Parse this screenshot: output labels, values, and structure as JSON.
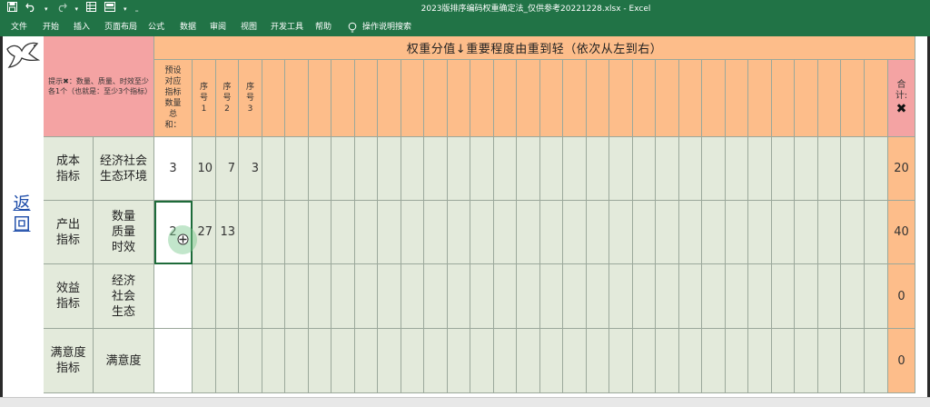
{
  "titlebar": {
    "doc_title": "2023版排序编码权重确定法_仅供参考20221228.xlsx  -  Excel",
    "qat": {
      "save_icon": "save-icon",
      "undo_icon": "undo-icon",
      "redo_icon": "redo-icon",
      "customize_icon": "dropdown-icon"
    }
  },
  "ribbon": {
    "tabs": [
      "文件",
      "开始",
      "插入",
      "页面布局",
      "公式",
      "数据",
      "审阅",
      "视图",
      "开发工具",
      "帮助"
    ],
    "tell_me": "操作说明搜索",
    "tell_me_icon": "lightbulb-icon"
  },
  "sheet": {
    "back_label": "返回",
    "logo_icon": "dove-icon",
    "header_banner": "权重分值↓重要程度由重到轻（依次从左到右）",
    "hint_text": "提示✖：数量、质量、时效至少各1个（也就是：至少3个指标）",
    "preset_header": "预设对应指标数量总和：",
    "seq_header_prefix": "序号",
    "seq_numbers": [
      "1",
      "2",
      "3"
    ],
    "total_header": "合计:",
    "total_mark": "✖",
    "rows": [
      {
        "category": "成本指标",
        "sub": "经济社会生态环境",
        "preset": "3",
        "values": [
          "10",
          "7",
          "3"
        ],
        "total": "20"
      },
      {
        "category": "产出指标",
        "sub": "数量质量时效",
        "preset": "2",
        "values": [
          "27",
          "13",
          ""
        ],
        "total": "40"
      },
      {
        "category": "效益指标",
        "sub": "经济社会生态",
        "preset": "",
        "values": [
          "",
          "",
          ""
        ],
        "total": "0"
      },
      {
        "category": "满意度指标",
        "sub": "满意度",
        "preset": "",
        "values": [
          "",
          "",
          ""
        ],
        "total": "0"
      }
    ]
  },
  "colors": {
    "excel_green": "#217346",
    "header_orange": "#fdbd8a",
    "hint_pink": "#f4a3a3",
    "cell_green": "#e3eadb",
    "link_blue": "#1f4eaa"
  }
}
